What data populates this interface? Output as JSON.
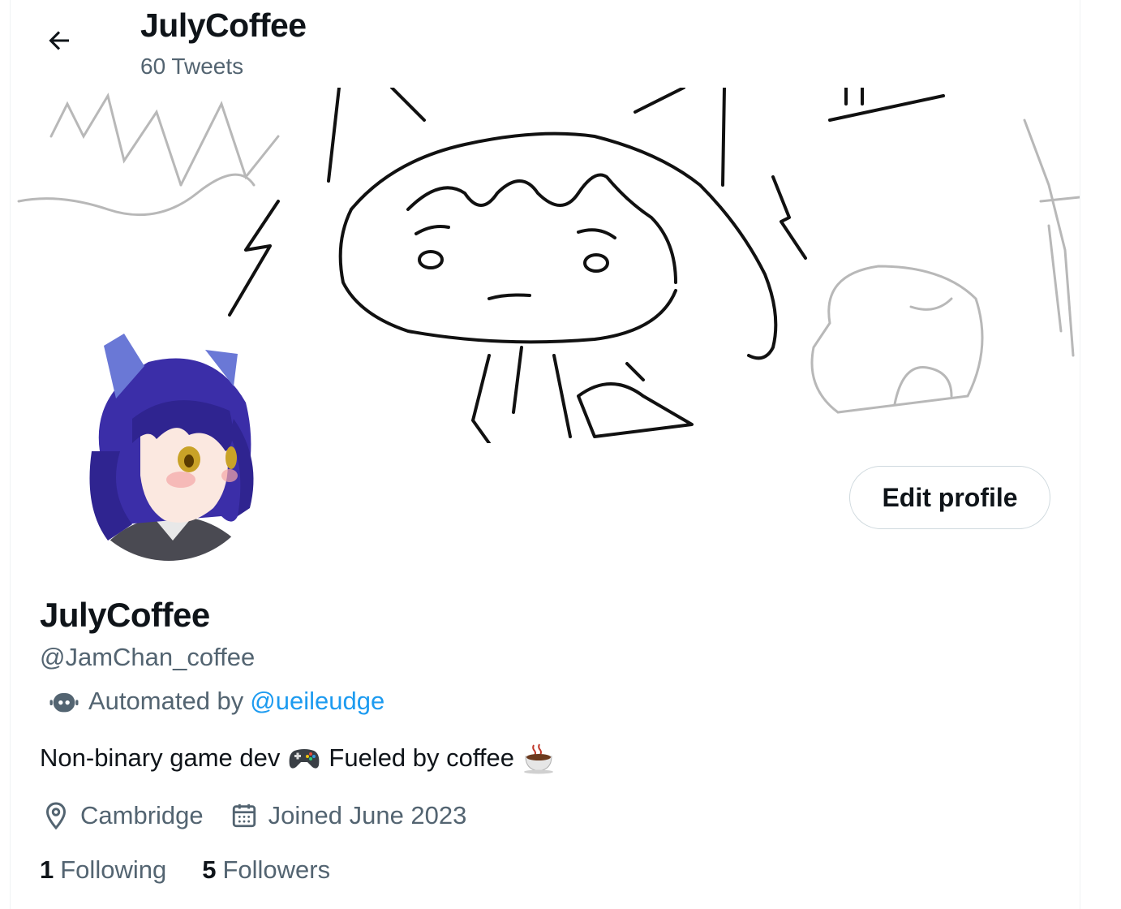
{
  "header": {
    "title": "JulyCoffee",
    "tweet_count": "60 Tweets"
  },
  "profile": {
    "display_name": "JulyCoffee",
    "handle": "@JamChan_coffee",
    "automated_prefix": "Automated by",
    "automated_by": "@ueileudge",
    "bio_part1": "Non-binary game dev",
    "bio_part2": "Fueled by coffee",
    "bio_emojis": [
      "video-game-controller",
      "hot-beverage"
    ],
    "location": "Cambridge",
    "joined": "Joined June 2023",
    "edit_button": "Edit profile"
  },
  "stats": {
    "following_count": "1",
    "following_label": "Following",
    "followers_count": "5",
    "followers_label": "Followers"
  },
  "colors": {
    "link": "#1d9bf0",
    "secondary_text": "#536471",
    "primary_text": "#0f1419",
    "border": "#cfd9de"
  }
}
